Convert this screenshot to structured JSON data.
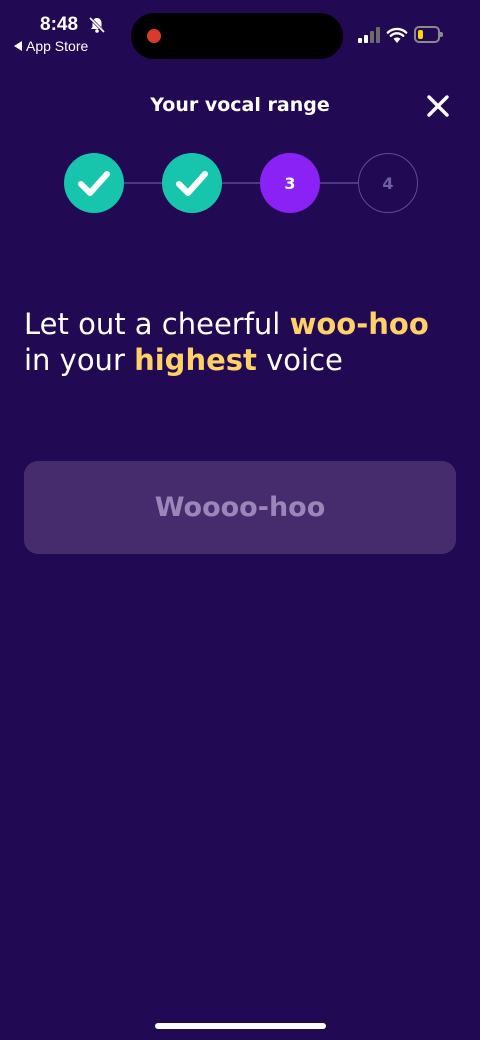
{
  "status_bar": {
    "time": "8:48",
    "back_label": "App Store",
    "icons": [
      "bell-off-icon",
      "signal-icon",
      "wifi-icon",
      "battery-icon"
    ],
    "battery_level": 0.25
  },
  "header": {
    "title": "Your vocal range",
    "close_icon": "close-icon"
  },
  "stepper": {
    "steps": [
      {
        "label": "1",
        "state": "done"
      },
      {
        "label": "2",
        "state": "done"
      },
      {
        "label": "3",
        "state": "current"
      },
      {
        "label": "4",
        "state": "pending"
      }
    ]
  },
  "prompt": {
    "part1": "Let out a cheerful ",
    "highlight1": "woo-hoo",
    "part2": " in your ",
    "highlight2": "highest",
    "part3": " voice"
  },
  "response": {
    "placeholder": "Woooo-hoo"
  },
  "colors": {
    "background": "#210953",
    "done": "#17c5ad",
    "current": "#8a22f5",
    "highlight": "#ffd166",
    "field": "#472c6d"
  }
}
